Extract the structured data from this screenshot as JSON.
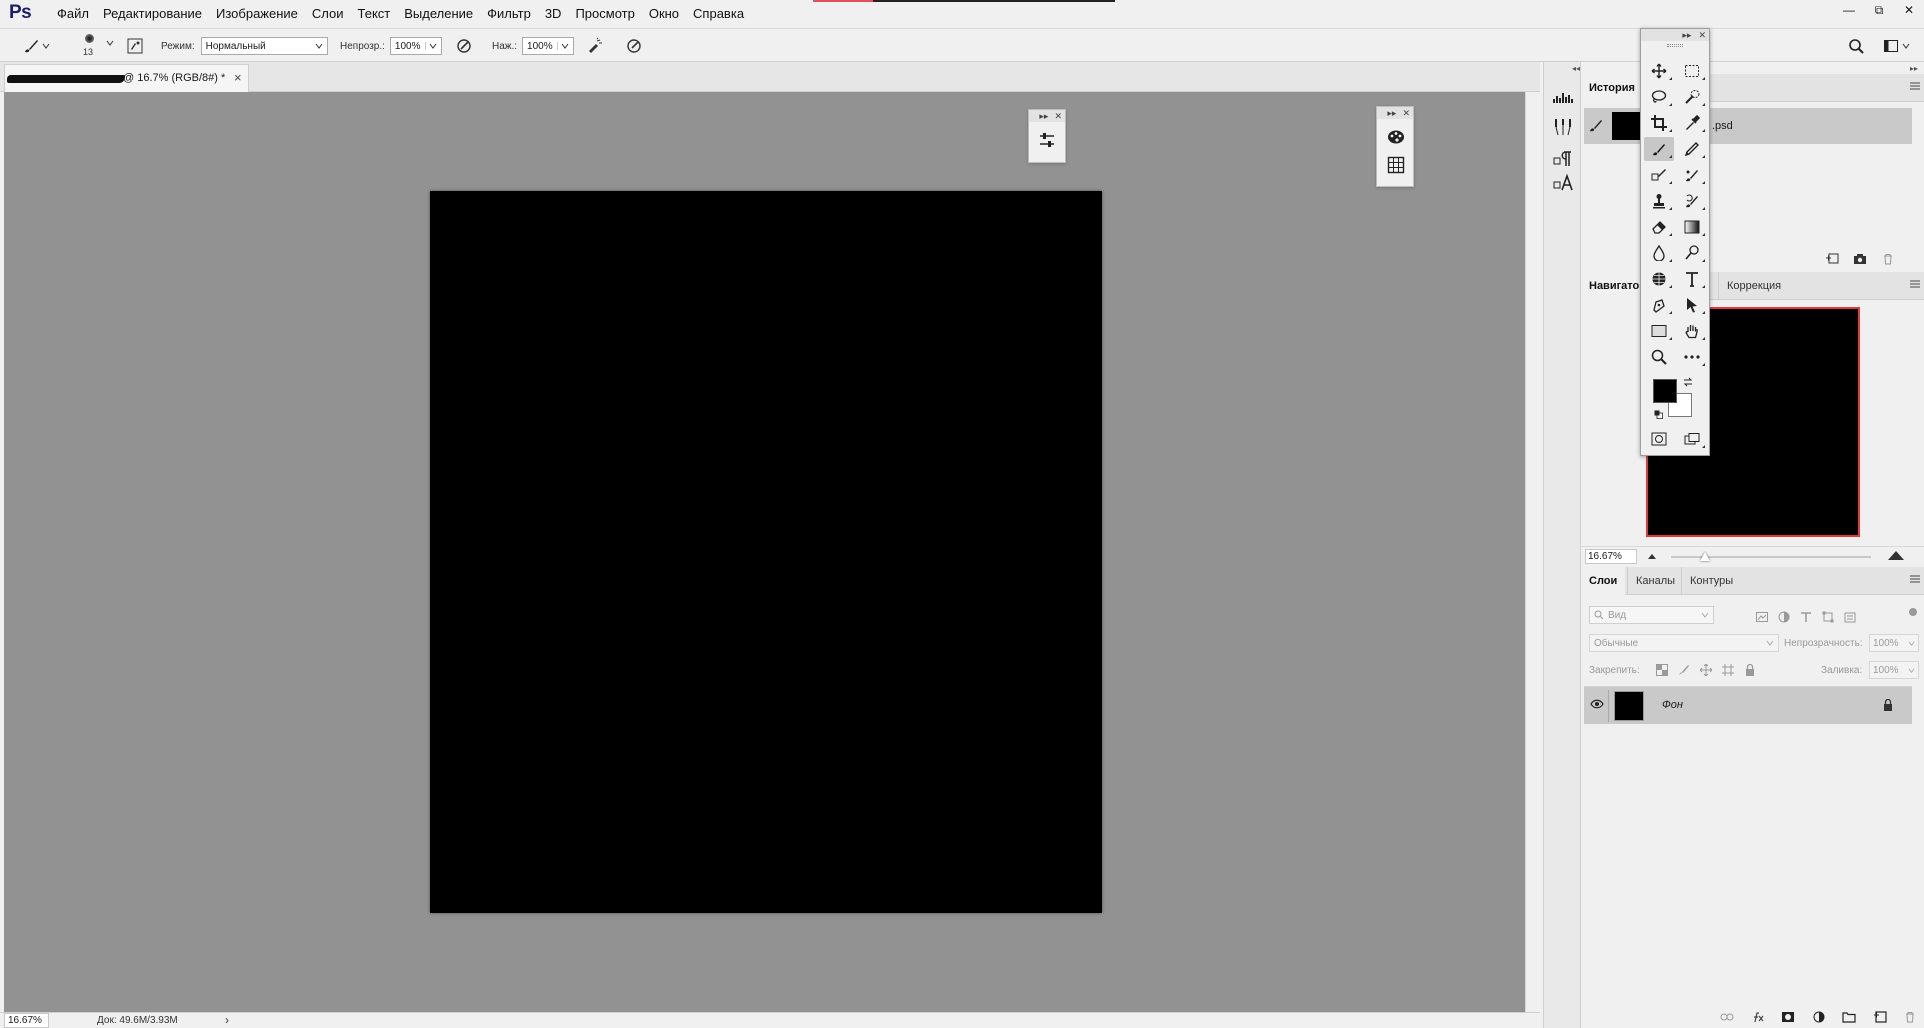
{
  "app": {
    "logo": "Ps"
  },
  "menu": [
    "Файл",
    "Редактирование",
    "Изображение",
    "Слои",
    "Текст",
    "Выделение",
    "Фильтр",
    "3D",
    "Просмотр",
    "Окно",
    "Справка"
  ],
  "window_controls": {
    "minimize": "—",
    "restore": "⧉",
    "close": "✕"
  },
  "options_bar": {
    "brush_size": "13",
    "mode_label": "Режим:",
    "mode_value": "Нормальный",
    "opacity_label": "Непрозр.:",
    "opacity_value": "100%",
    "flow_label": "Наж.:",
    "flow_value": "100%"
  },
  "document": {
    "tab_title": "@ 16.7% (RGB/8#) *",
    "close": "×"
  },
  "status": {
    "zoom": "16.67%",
    "doc_size": "Док: 49.6M/3.93M",
    "arrow": "›"
  },
  "history_panel": {
    "tab": "История",
    "snapshot_name": ".psd"
  },
  "navigator_panel": {
    "tabs": [
      "Навигатор",
      "Коррекция"
    ],
    "zoom": "16.67%",
    "slider_position": 0.17
  },
  "layers_panel": {
    "tabs": [
      "Слои",
      "Каналы",
      "Контуры"
    ],
    "filter_placeholder": "Вид",
    "blend_mode": "Обычные",
    "opacity_label": "Непрозрачность:",
    "opacity_value": "100%",
    "lock_label": "Закрепить:",
    "fill_label": "Заливка:",
    "fill_value": "100%",
    "layers": [
      {
        "name": "Фон",
        "visible": true,
        "locked": true
      }
    ]
  },
  "floating_panels": {
    "collapse": "▸▸",
    "close": "✕"
  },
  "colors": {
    "foreground": "#000000",
    "background": "#ffffff",
    "canvas": "#000000",
    "workspace": "#929292",
    "navigator_box": "#e03a3a"
  }
}
